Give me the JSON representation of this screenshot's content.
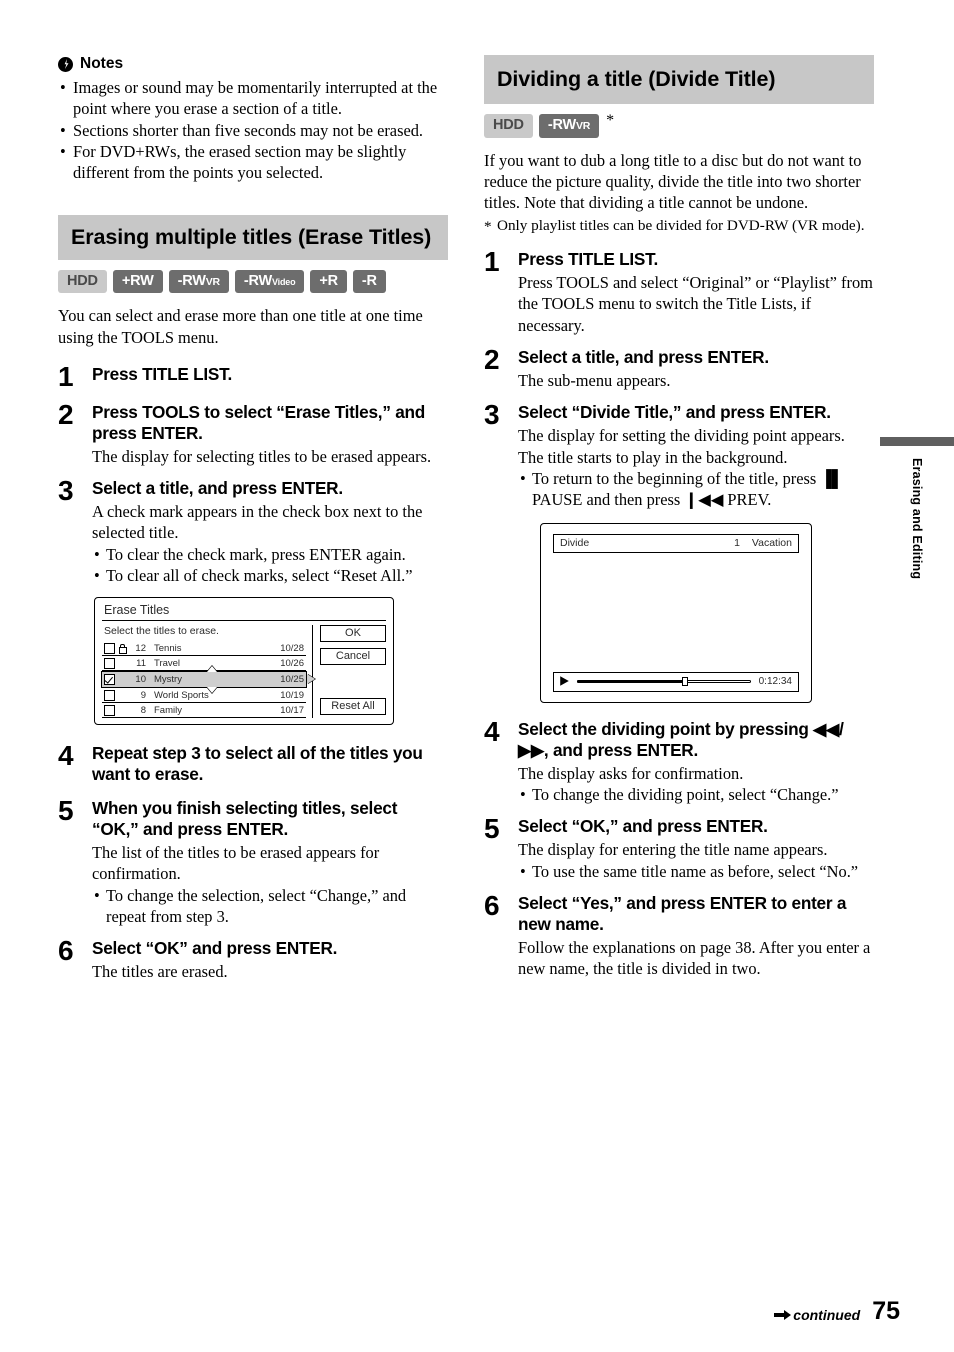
{
  "notes": {
    "heading": "Notes",
    "items": [
      "Images or sound may be momentarily interrupted at the point where you erase a section of a title.",
      "Sections shorter than five seconds may not be erased.",
      "For DVD+RWs, the erased section may be slightly different from the points you selected."
    ]
  },
  "left_section": {
    "heading": "Erasing multiple titles (Erase Titles)",
    "badges": [
      {
        "label": "HDD",
        "style": "light"
      },
      {
        "label": "+RW",
        "style": "dark"
      },
      {
        "label": "-RW",
        "sub": "VR",
        "style": "dark"
      },
      {
        "label": "-RW",
        "subsm": "Video",
        "style": "dark"
      },
      {
        "label": "+R",
        "style": "dark"
      },
      {
        "label": "-R",
        "style": "dark"
      }
    ],
    "intro": "You can select and erase more than one title at one time using the TOOLS menu.",
    "steps": [
      {
        "num": "1",
        "title": "Press TITLE LIST.",
        "desc": "",
        "bullets": []
      },
      {
        "num": "2",
        "title": "Press TOOLS to select “Erase Titles,” and press ENTER.",
        "desc": "The display for selecting titles to be erased appears.",
        "bullets": []
      },
      {
        "num": "3",
        "title": "Select a title, and press ENTER.",
        "desc": "A check mark appears in the check box next to the selected title.",
        "bullets": [
          "To clear the check mark, press ENTER again.",
          "To clear all of check marks, select “Reset All.”"
        ]
      },
      {
        "num": "4",
        "title": "Repeat step 3 to select all of the titles you want to erase.",
        "desc": "",
        "bullets": []
      },
      {
        "num": "5",
        "title": "When you finish selecting titles, select “OK,” and press ENTER.",
        "desc": "The list of the titles to be erased appears for confirmation.",
        "bullets": [
          "To change the selection, select “Change,” and repeat from step 3."
        ]
      },
      {
        "num": "6",
        "title": "Select “OK” and press ENTER.",
        "desc": "The titles are erased.",
        "bullets": []
      }
    ]
  },
  "erase_figure": {
    "title": "Erase Titles",
    "hint": "Select the titles to erase.",
    "rows": [
      {
        "checked": false,
        "locked": true,
        "no": "12",
        "name": "Tennis",
        "date": "10/28",
        "selected": false
      },
      {
        "checked": false,
        "locked": false,
        "no": "11",
        "name": "Travel",
        "date": "10/26",
        "selected": false
      },
      {
        "checked": true,
        "locked": false,
        "no": "10",
        "name": "Mystry",
        "date": "10/25",
        "selected": true
      },
      {
        "checked": false,
        "locked": false,
        "no": "9",
        "name": "World Sports",
        "date": "10/19",
        "selected": false
      },
      {
        "checked": false,
        "locked": false,
        "no": "8",
        "name": "Family",
        "date": "10/17",
        "selected": false
      }
    ],
    "buttons": [
      "OK",
      "Cancel",
      "Reset All"
    ]
  },
  "right_section": {
    "heading": "Dividing a title (Divide Title)",
    "badges": [
      {
        "label": "HDD",
        "style": "light"
      },
      {
        "label": "-RW",
        "sub": "VR",
        "style": "dark"
      }
    ],
    "badge_star": "*",
    "intro": "If you want to dub a long title to a disc but do not want to reduce the picture quality, divide the title into two shorter titles. Note that dividing a title cannot be undone.",
    "footnote": "Only playlist titles can be divided for DVD-RW (VR mode).",
    "steps": [
      {
        "num": "1",
        "title": "Press TITLE LIST.",
        "desc": "Press TOOLS and select “Original” or “Playlist” from the TOOLS menu to switch the Title Lists, if necessary.",
        "bullets": []
      },
      {
        "num": "2",
        "title": "Select a title, and press ENTER.",
        "desc": "The sub-menu appears.",
        "bullets": []
      },
      {
        "num": "3",
        "title": "Select “Divide Title,” and press ENTER.",
        "desc": "The display for setting the dividing point appears. The title starts to play in the background.",
        "bullets": [
          "To return to the beginning of the title, press ▐▌ PAUSE and then press ❙◀◀ PREV."
        ]
      },
      {
        "num": "4",
        "title": "Select the dividing point by pressing ◀◀/ ▶▶, and press ENTER.",
        "desc": "The display asks for confirmation.",
        "bullets": [
          "To change the dividing point, select “Change.”"
        ]
      },
      {
        "num": "5",
        "title": "Select “OK,” and press ENTER.",
        "desc": "The display for entering the title name appears.",
        "bullets": [
          "To use the same title name as before, select “No.”"
        ]
      },
      {
        "num": "6",
        "title": "Select “Yes,” and press ENTER to enter a new name.",
        "desc": "Follow the explanations on page 38. After you enter a new name, the title is divided in two.",
        "bullets": []
      }
    ]
  },
  "divide_figure": {
    "label": "Divide",
    "index": "1",
    "title_name": "Vacation",
    "time": "0:12:34",
    "progress_percent": 62
  },
  "side_tab": {
    "label": "Erasing and Editing",
    "bar_color": "#5f5f5f"
  },
  "footer": {
    "continued": "continued",
    "page_number": "75"
  }
}
